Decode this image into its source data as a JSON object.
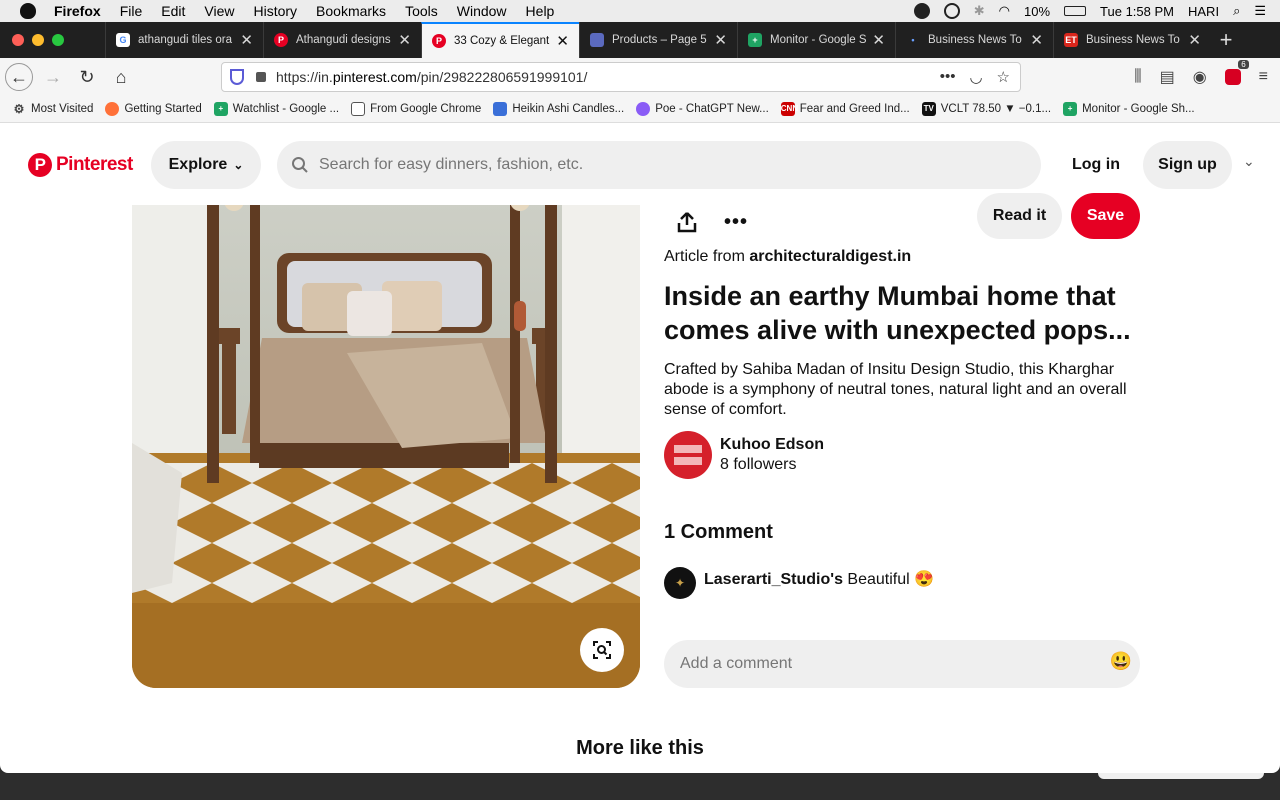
{
  "menubar": {
    "app": "Firefox",
    "items": [
      "File",
      "Edit",
      "View",
      "History",
      "Bookmarks",
      "Tools",
      "Window",
      "Help"
    ],
    "battery": "10%",
    "clock": "Tue 1:58 PM",
    "user": "HARI"
  },
  "tabs": [
    {
      "title": "athangudi tiles ora",
      "icon": "google-icon"
    },
    {
      "title": "Athangudi designs",
      "icon": "pinterest-icon"
    },
    {
      "title": "33 Cozy & Elegant",
      "icon": "pinterest-icon",
      "active": true
    },
    {
      "title": "Products – Page 5",
      "icon": "products-icon"
    },
    {
      "title": "Monitor - Google S",
      "icon": "sheets-icon"
    },
    {
      "title": "Business News To",
      "icon": "dot-icon"
    },
    {
      "title": "Business News To",
      "icon": "et-icon"
    }
  ],
  "address": {
    "prefix": "https://in.",
    "domain": "pinterest.com",
    "path": "/pin/298222806591999101/"
  },
  "extension_badge": "6",
  "bookmarks": [
    {
      "label": "Most Visited",
      "icon": "gear-icon"
    },
    {
      "label": "Getting Started",
      "icon": "firefox-icon"
    },
    {
      "label": "Watchlist - Google ...",
      "icon": "sheets-icon"
    },
    {
      "label": "From Google Chrome",
      "icon": "folder-icon"
    },
    {
      "label": "Heikin Ashi Candles...",
      "icon": "site-icon"
    },
    {
      "label": "Poe - ChatGPT New...",
      "icon": "poe-icon"
    },
    {
      "label": "Fear and Greed Ind...",
      "icon": "cnn-icon"
    },
    {
      "label": "VCLT 78.50 ▼ −0.1...",
      "icon": "tradingview-icon"
    },
    {
      "label": "Monitor - Google Sh...",
      "icon": "sheets-icon"
    }
  ],
  "header": {
    "logo": "Pinterest",
    "explore": "Explore",
    "search_placeholder": "Search for easy dinners, fashion, etc.",
    "login": "Log in",
    "signup": "Sign up"
  },
  "pin": {
    "read_it": "Read it",
    "save": "Save",
    "article_from": "Article from",
    "source": "architecturaldigest.in",
    "title": "Inside an earthy Mumbai home that comes alive with unexpected pops...",
    "description": "Crafted by Sahiba Madan of Insitu Design Studio, this Kharghar abode is a symphony of neutral tones, natural light and an overall sense of comfort.",
    "author": "Kuhoo Edson",
    "followers": "8 followers"
  },
  "comments": {
    "heading": "1 Comment",
    "items": [
      {
        "user": "Laserarti_Studio's",
        "text": "Beautiful",
        "emoji": "😍"
      }
    ],
    "add_placeholder": "Add a comment",
    "emoji_button": "😃"
  },
  "more_like_this": "More like this",
  "colors": {
    "brand": "#e60023",
    "tab_accent": "#0a84ff"
  }
}
